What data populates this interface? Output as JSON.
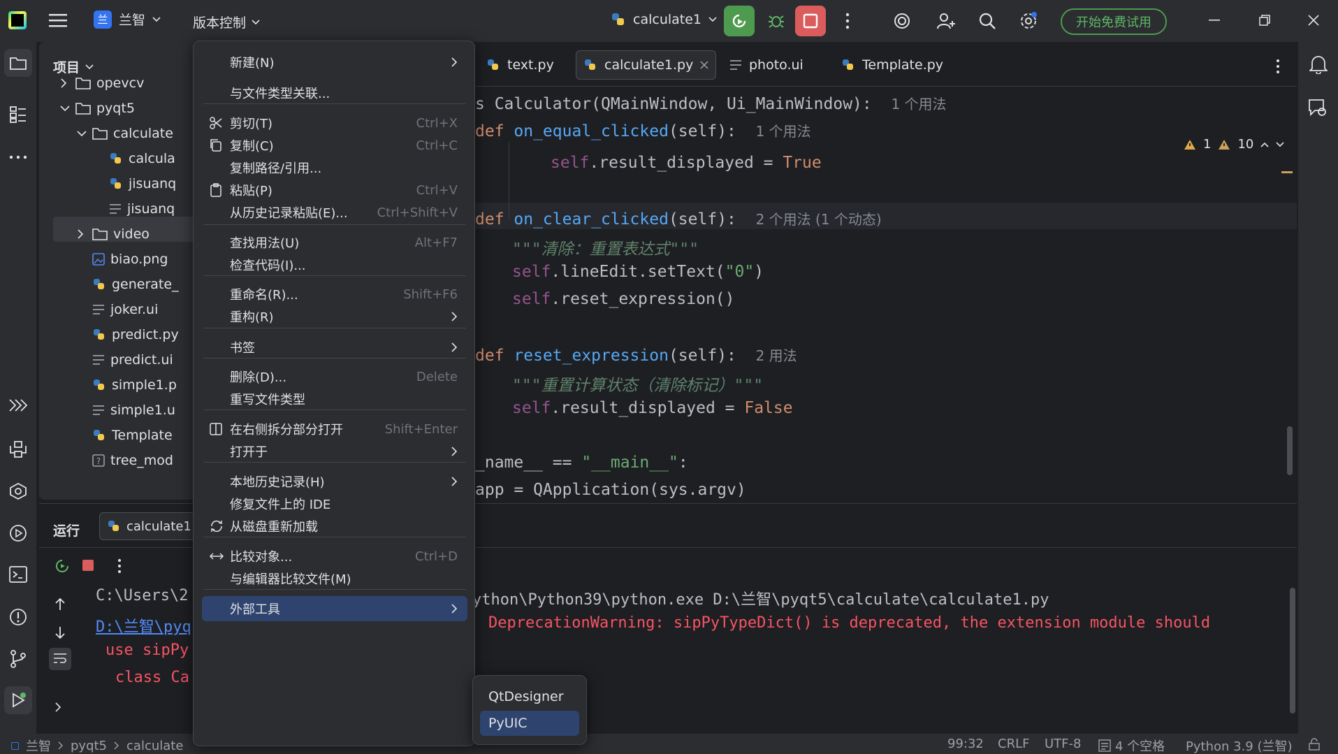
{
  "titlebar": {
    "project_name": "兰智",
    "project_badge": "兰",
    "vcs_label": "版本控制",
    "run_config": "calculate1",
    "trial_button": "开始免费试用"
  },
  "project_panel": {
    "title": "项目",
    "items": [
      {
        "label": "opevcv",
        "type": "folder"
      },
      {
        "label": "pyqt5",
        "type": "folder"
      },
      {
        "label": "calculate",
        "type": "folder"
      },
      {
        "label": "calcula",
        "type": "python"
      },
      {
        "label": "jisuanq",
        "type": "python"
      },
      {
        "label": "jisuanq",
        "type": "ui"
      },
      {
        "label": "video",
        "type": "folder"
      },
      {
        "label": "biao.png",
        "type": "image"
      },
      {
        "label": "generate_",
        "type": "python"
      },
      {
        "label": "joker.ui",
        "type": "ui"
      },
      {
        "label": "predict.py",
        "type": "python"
      },
      {
        "label": "predict.ui",
        "type": "ui"
      },
      {
        "label": "simple1.p",
        "type": "python"
      },
      {
        "label": "simple1.u",
        "type": "ui"
      },
      {
        "label": "Template",
        "type": "python"
      },
      {
        "label": "tree_mod",
        "type": "unknown"
      }
    ]
  },
  "editor": {
    "tabs": [
      {
        "label": "text.py"
      },
      {
        "label": "calculate1.py"
      },
      {
        "label": "photo.ui"
      },
      {
        "label": "Template.py"
      }
    ],
    "warnings": {
      "weak": "1",
      "warn": "10"
    },
    "code": {
      "l1": "s Calculator(QMainWindow, Ui_MainWindow):",
      "l1_hint": "1 个用法",
      "l2_kw": "def ",
      "l2_fn": "on_equal_clicked",
      "l2_rest": "(self):",
      "l2_hint": "1 个用法",
      "l3_self": "self",
      "l3_attr": ".result_displayed",
      "l3_rest": " = ",
      "l3_val": "True",
      "l4_kw": "def ",
      "l4_fn": "on_clear_clicked",
      "l4_rest": "(self):",
      "l4_hint": "2 个用法 (1 个动态)",
      "l5_doc": "\"\"\"清除：重置表达式\"\"\"",
      "l6_self": "self",
      "l6_rest": ".lineEdit.setText(",
      "l6_str": "\"0\"",
      "l6_end": ")",
      "l7_self": "self",
      "l7_rest": ".reset_expression()",
      "l8_kw": "def ",
      "l8_fn": "reset_expression",
      "l8_rest": "(self):",
      "l8_hint": "2 用法",
      "l9_doc": "\"\"\"重置计算状态（清除标记）\"\"\"",
      "l10_self": "self",
      "l10_attr": ".result_displayed",
      "l10_rest": " = ",
      "l10_val": "False",
      "l11_a": "_name__ == ",
      "l11_str": "\"__main__\"",
      "l11_end": ":",
      "l12": "app = QApplication(sys.argv)"
    }
  },
  "run_panel": {
    "title": "运行",
    "tab_label": "calculate1",
    "output": {
      "line1_a": "C:\\Users\\2",
      "line1_b": "ython\\Python39\\python.exe D:\\兰智\\pyqt5\\calculate\\calculate1.py",
      "line2_link": "D:\\兰智\\pyq",
      "line2_b": "DeprecationWarning: sipPyTypeDict() is deprecated, the extension module should",
      "line3": "use sipPy",
      "line4": "class Ca"
    }
  },
  "context_menu": {
    "items": [
      {
        "label": "新建(N)",
        "shortcut": "",
        "submenu": true
      },
      {
        "label": "与文件类型关联...",
        "shortcut": "",
        "submenu": false
      },
      {
        "label": "剪切(T)",
        "shortcut": "Ctrl+X",
        "submenu": false
      },
      {
        "label": "复制(C)",
        "shortcut": "Ctrl+C",
        "submenu": false
      },
      {
        "label": "复制路径/引用...",
        "shortcut": "",
        "submenu": false
      },
      {
        "label": "粘贴(P)",
        "shortcut": "Ctrl+V",
        "submenu": false
      },
      {
        "label": "从历史记录粘贴(E)...",
        "shortcut": "Ctrl+Shift+V",
        "submenu": false
      },
      {
        "label": "查找用法(U)",
        "shortcut": "Alt+F7",
        "submenu": false
      },
      {
        "label": "检查代码(I)...",
        "shortcut": "",
        "submenu": false
      },
      {
        "label": "重命名(R)...",
        "shortcut": "Shift+F6",
        "submenu": false
      },
      {
        "label": "重构(R)",
        "shortcut": "",
        "submenu": true
      },
      {
        "label": "书签",
        "shortcut": "",
        "submenu": true
      },
      {
        "label": "删除(D)...",
        "shortcut": "Delete",
        "submenu": false
      },
      {
        "label": "重写文件类型",
        "shortcut": "",
        "submenu": false
      },
      {
        "label": "在右侧拆分部分打开",
        "shortcut": "Shift+Enter",
        "submenu": false
      },
      {
        "label": "打开于",
        "shortcut": "",
        "submenu": true
      },
      {
        "label": "本地历史记录(H)",
        "shortcut": "",
        "submenu": true
      },
      {
        "label": "修复文件上的 IDE",
        "shortcut": "",
        "submenu": false
      },
      {
        "label": "从磁盘重新加载",
        "shortcut": "",
        "submenu": false
      },
      {
        "label": "比较对象...",
        "shortcut": "Ctrl+D",
        "submenu": false
      },
      {
        "label": "与编辑器比较文件(M)",
        "shortcut": "",
        "submenu": false
      },
      {
        "label": "外部工具",
        "shortcut": "",
        "submenu": true
      }
    ]
  },
  "submenu": {
    "items": [
      {
        "label": "QtDesigner"
      },
      {
        "label": "PyUIC"
      }
    ]
  },
  "statusbar": {
    "crumb1": "兰智",
    "crumb2": "pyqt5",
    "crumb3": "calculate",
    "position": "99:32",
    "line_sep": "CRLF",
    "encoding": "UTF-8",
    "indent": "4 个空格",
    "interpreter": "Python 3.9 (兰智)"
  },
  "colors": {
    "accent": "#2e436e",
    "run_green": "#4e9a4e",
    "stop_red": "#db5c5c",
    "error_red": "#f75464"
  }
}
